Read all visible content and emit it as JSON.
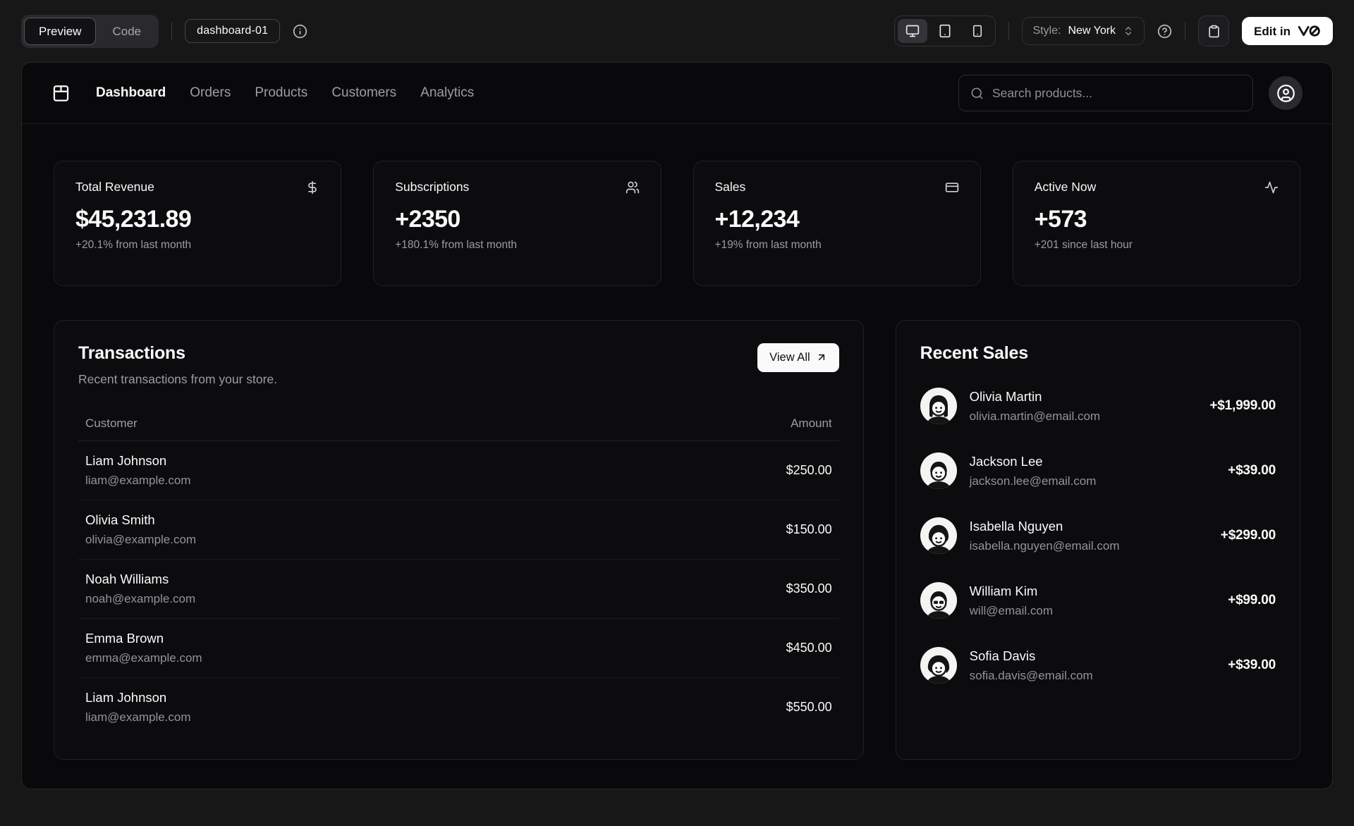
{
  "toolbar": {
    "tabs": {
      "preview": "Preview",
      "code": "Code"
    },
    "block_name": "dashboard-01",
    "style_label": "Style:",
    "style_value": "New York",
    "edit_label": "Edit in",
    "edit_brand": "v0",
    "icons": [
      "info-icon",
      "monitor-icon",
      "tablet-icon",
      "smartphone-icon",
      "chevrons-up-down-icon",
      "help-circle-icon",
      "clipboard-icon"
    ]
  },
  "nav": {
    "logo_icon": "store-icon",
    "items": [
      {
        "label": "Dashboard",
        "active": true
      },
      {
        "label": "Orders",
        "active": false
      },
      {
        "label": "Products",
        "active": false
      },
      {
        "label": "Customers",
        "active": false
      },
      {
        "label": "Analytics",
        "active": false
      }
    ],
    "search": {
      "placeholder": "Search products...",
      "icon": "search-icon"
    },
    "account_icon": "circle-user-icon"
  },
  "stats": [
    {
      "title": "Total Revenue",
      "icon": "dollar-sign-icon",
      "value": "$45,231.89",
      "change": "+20.1% from last month"
    },
    {
      "title": "Subscriptions",
      "icon": "users-icon",
      "value": "+2350",
      "change": "+180.1% from last month"
    },
    {
      "title": "Sales",
      "icon": "credit-card-icon",
      "value": "+12,234",
      "change": "+19% from last month"
    },
    {
      "title": "Active Now",
      "icon": "activity-icon",
      "value": "+573",
      "change": "+201 since last hour"
    }
  ],
  "transactions": {
    "title": "Transactions",
    "description": "Recent transactions from your store.",
    "view_all_label": "View All",
    "view_all_icon": "arrow-up-right-icon",
    "columns": {
      "customer": "Customer",
      "amount": "Amount"
    },
    "rows": [
      {
        "name": "Liam Johnson",
        "email": "liam@example.com",
        "amount": "$250.00"
      },
      {
        "name": "Olivia Smith",
        "email": "olivia@example.com",
        "amount": "$150.00"
      },
      {
        "name": "Noah Williams",
        "email": "noah@example.com",
        "amount": "$350.00"
      },
      {
        "name": "Emma Brown",
        "email": "emma@example.com",
        "amount": "$450.00"
      },
      {
        "name": "Liam Johnson",
        "email": "liam@example.com",
        "amount": "$550.00"
      }
    ]
  },
  "recent_sales": {
    "title": "Recent Sales",
    "items": [
      {
        "name": "Olivia Martin",
        "email": "olivia.martin@email.com",
        "amount": "+$1,999.00"
      },
      {
        "name": "Jackson Lee",
        "email": "jackson.lee@email.com",
        "amount": "+$39.00"
      },
      {
        "name": "Isabella Nguyen",
        "email": "isabella.nguyen@email.com",
        "amount": "+$299.00"
      },
      {
        "name": "William Kim",
        "email": "will@email.com",
        "amount": "+$99.00"
      },
      {
        "name": "Sofia Davis",
        "email": "sofia.davis@email.com",
        "amount": "+$39.00"
      }
    ]
  },
  "colors": {
    "app_background": "#171717",
    "preview_background": "#09090b",
    "card_background": "#0c0c0e",
    "card_border": "#212126",
    "muted_text": "#9c9ca4",
    "primary_text": "#fafafa",
    "accent_button": "#ffffff"
  }
}
